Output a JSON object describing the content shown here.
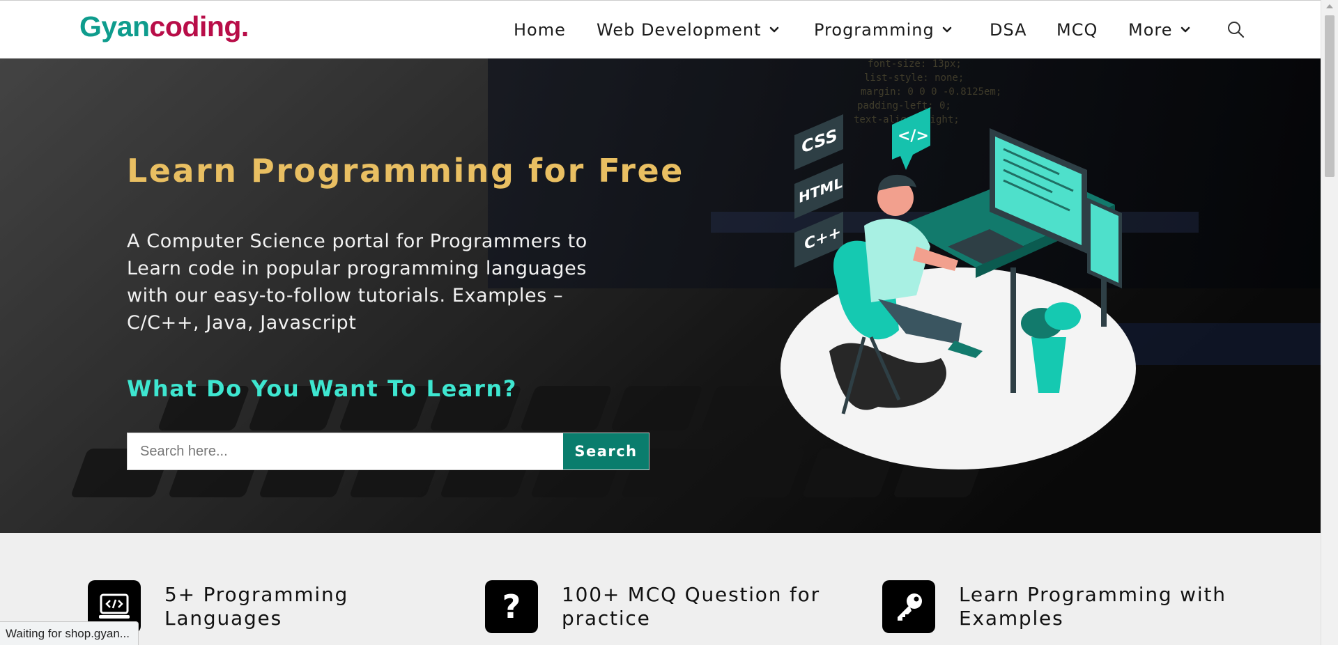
{
  "header": {
    "logo_part1": "Gyan",
    "logo_part2": "coding.",
    "nav": [
      {
        "label": "Home",
        "dropdown": false
      },
      {
        "label": "Web Development",
        "dropdown": true
      },
      {
        "label": "Programming",
        "dropdown": true
      },
      {
        "label": "DSA",
        "dropdown": false
      },
      {
        "label": "MCQ",
        "dropdown": false
      },
      {
        "label": "More",
        "dropdown": true
      }
    ],
    "search_icon": "search-icon"
  },
  "hero": {
    "title": "Learn Programming for Free",
    "description": "A Computer Science portal for Programmers to Learn code in popular programming languages with our easy-to-follow tutorials. Examples – C/C++, Java, Javascript",
    "subtitle": "What Do You Want To Learn?",
    "search_placeholder": "Search here...",
    "search_button": "Search",
    "illustration_badges": [
      "CSS",
      "HTML",
      "C++",
      "</>"
    ]
  },
  "features": [
    {
      "icon": "code-monitor-icon",
      "line1": "5+ Programming",
      "line2": "Languages"
    },
    {
      "icon": "question-mark-icon",
      "line1": "100+ MCQ Question for",
      "line2": "practice"
    },
    {
      "icon": "key-icon",
      "line1": "Learn Programming with",
      "line2": "Examples"
    }
  ],
  "status_bar": "Waiting for shop.gyan...",
  "colors": {
    "brand_teal": "#0e9c8d",
    "brand_crimson": "#b80d48",
    "title_gold": "#e9bf62",
    "subtitle_cyan": "#3ee6d0",
    "search_button": "#0a7d6d"
  }
}
